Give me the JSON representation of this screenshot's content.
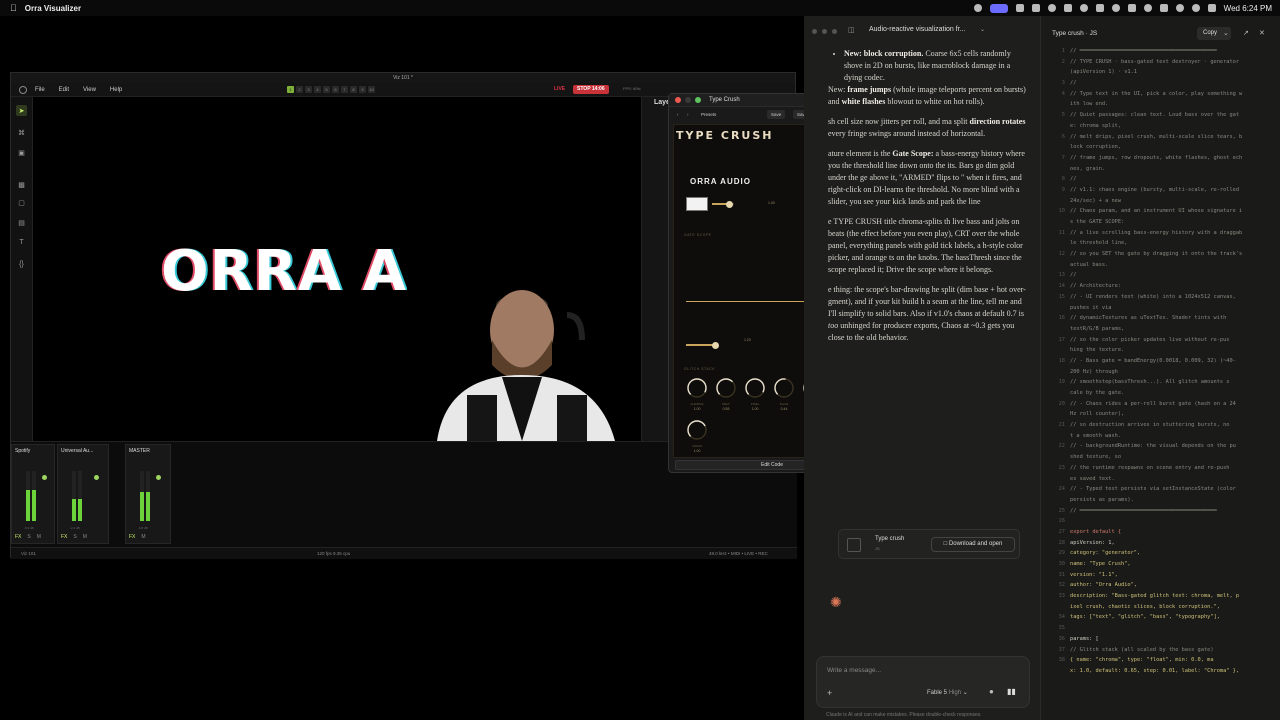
{
  "menubar": {
    "app_name": "Orra Visualizer",
    "clock": "Wed 6:24 PM"
  },
  "viz": {
    "window_title": "Viz 101 *",
    "menu": [
      "File",
      "Edit",
      "View",
      "Help"
    ],
    "scene_tabs": [
      "1",
      "2",
      "3",
      "4",
      "5",
      "6",
      "7",
      "8",
      "9",
      "10"
    ],
    "live_label": "LIVE",
    "stop_label": "STOP 14:06",
    "fps_top": "FPS: 60fc",
    "layers_title": "Layers",
    "canvas_text": "ORRA AUDIO",
    "mixer": {
      "strips": [
        {
          "name": "Spotify",
          "db": "-6.9 dB",
          "level": 0.62
        },
        {
          "name": "Universal Au...",
          "db": "-2.2 dB",
          "level": 0.45
        },
        {
          "name": "MASTER",
          "db": "-6.8 dB",
          "level": 0.58
        }
      ],
      "foot": [
        "FX",
        "S",
        "M"
      ]
    },
    "statusbar": {
      "scene": "Viz 101",
      "fps": "120 fps  9.35 cpu",
      "audio": "48.0 kHz  • MIDI  • LIVE  • REC"
    }
  },
  "type_crush": {
    "window_title": "Type Crush",
    "presets_label": "Presets",
    "save": "Save",
    "save_as": "Save As",
    "delete": "Delete",
    "heading": "TYPE CRUSH",
    "sample_text": "ORRA AUDIO",
    "text_size_val": "1.00",
    "gate_section": "GATE SCOPE",
    "drive_val": "1.20",
    "glitch_section": "GLITCH STACK",
    "knobs": [
      {
        "label": "CHROMA",
        "value": "1.00",
        "level": 0.7
      },
      {
        "label": "MELT",
        "value": "0.55",
        "level": 0.5
      },
      {
        "label": "PIXEL",
        "value": "1.00",
        "level": 0.7
      },
      {
        "label": "SLICE",
        "value": "0.44",
        "level": 0.4
      },
      {
        "label": "GHOST",
        "value": "0.50",
        "level": 0.5
      },
      {
        "label": "CORRU",
        "value": "1.00",
        "level": 0.7
      },
      {
        "label": "GRAIN",
        "value": "1.00",
        "level": 0.55
      }
    ],
    "edit_code": "Edit Code"
  },
  "chat": {
    "title": "Audio-reactive visualization fr...",
    "para1_label": "New: block corruption.",
    "para1_text": " Coarse 6x5 cells randomly shove in 2D on bursts, like macroblock damage in a dying codec.",
    "para2a": "New: ",
    "para2_bold1": "frame jumps",
    "para2b": " (whole image teleports percent on bursts) and ",
    "para2_bold2": "white flashes",
    "para2c": " blowout to white on hot rolls).",
    "para3a": "sh cell size now jitters per roll, and ma split ",
    "para3_bold": "direction rotates",
    "para3b": " every fringe swings around instead of horizontal.",
    "para4a": "ature element is the ",
    "para4_bold": "Gate Scope:",
    "para4b": " a bass-energy history where you the threshold line down onto the its. Bars go dim gold under the ge above it, \"ARMED\" flips to \" when it fires, and right-click on DI-learns the threshold. No more blind with a slider, you see your kick lands and park the line",
    "para5": "e TYPE CRUSH title chroma-splits th live bass and jolts on beats (the effect before you even play), CRT over the whole panel, everything panels with gold tick labels, a h-style color picker, and orange ts on the knobs. The bassThresh since the scope replaced it; Drive the scope where it belongs.",
    "para6a": "e thing: the scope's bar-drawing he split (dim base + hot over-gment), and if your kit build h a seam at the line, tell me and I'll simplify to solid bars. Also if v1.0's chaos at default 0.7 is ",
    "para6_em": "too",
    "para6b": " unhinged for producer exports, Chaos at ~0.3 gets you close to the old behavior.",
    "artifact_name": "Type crush",
    "artifact_sub": "JS",
    "download_label": "Download and open",
    "composer_placeholder": "Write a message...",
    "model": "Fable 5",
    "effort": "High",
    "disclaimer": "Claude is AI and can make mistakes. Please double-check responses."
  },
  "code": {
    "title": "Type crush · JS",
    "copy_label": "Copy",
    "lines": [
      {
        "n": "1",
        "t": "// ═══════════════════════════════════════════",
        "k": "c-com"
      },
      {
        "n": "2",
        "t": "//  TYPE CRUSH · bass-gated text destroyer · generator",
        "k": "c-com"
      },
      {
        "n": "",
        "t": "(apiVersion 1) · v1.1",
        "k": "c-com"
      },
      {
        "n": "3",
        "t": "//",
        "k": "c-com"
      },
      {
        "n": "4",
        "t": "//  Type text in the UI, pick a color, play something w",
        "k": "c-com"
      },
      {
        "n": "",
        "t": "ith low end.",
        "k": "c-com"
      },
      {
        "n": "5",
        "t": "//  Quiet passages: clean text. Loud bass over the gat",
        "k": "c-com"
      },
      {
        "n": "",
        "t": "e: chroma split,",
        "k": "c-com"
      },
      {
        "n": "6",
        "t": "//  melt drips, pixel crush, multi-scale slice tears, b",
        "k": "c-com"
      },
      {
        "n": "",
        "t": "lock corruption,",
        "k": "c-com"
      },
      {
        "n": "7",
        "t": "//  frame jumps, row dropouts, white flashes, ghost ech",
        "k": "c-com"
      },
      {
        "n": "",
        "t": "oes, grain.",
        "k": "c-com"
      },
      {
        "n": "8",
        "t": "//",
        "k": "c-com"
      },
      {
        "n": "9",
        "t": "//  v1.1: chaos engine (bursty, multi-scale, re-rolled",
        "k": "c-com"
      },
      {
        "n": "",
        "t": "24x/sec) + a new",
        "k": "c-com"
      },
      {
        "n": "10",
        "t": "//  Chaos param, and an instrument UI whose signature i",
        "k": "c-com"
      },
      {
        "n": "",
        "t": "s the GATE SCOPE:",
        "k": "c-com"
      },
      {
        "n": "11",
        "t": "//  a live scrolling bass-energy history with a draggab",
        "k": "c-com"
      },
      {
        "n": "",
        "t": "le threshold line,",
        "k": "c-com"
      },
      {
        "n": "12",
        "t": "//  so you SET the gate by dragging it onto the track's",
        "k": "c-com"
      },
      {
        "n": "",
        "t": "actual bass.",
        "k": "c-com"
      },
      {
        "n": "13",
        "t": "//",
        "k": "c-com"
      },
      {
        "n": "14",
        "t": "//  Architecture:",
        "k": "c-com"
      },
      {
        "n": "15",
        "t": "//    - UI renders text (white) into a 1024x512 canvas,",
        "k": "c-com"
      },
      {
        "n": "",
        "t": "pushes it via",
        "k": "c-com"
      },
      {
        "n": "16",
        "t": "//      dynamicTextures as uTextTex. Shader tints with",
        "k": "c-com"
      },
      {
        "n": "",
        "t": "textR/G/B params,",
        "k": "c-com"
      },
      {
        "n": "17",
        "t": "//      so the color picker updates live without re-pus",
        "k": "c-com"
      },
      {
        "n": "",
        "t": "hing the texture.",
        "k": "c-com"
      },
      {
        "n": "18",
        "t": "//    - Bass gate = bandEnergy(0.0018, 0.009, 32) (~40-",
        "k": "c-com"
      },
      {
        "n": "",
        "t": "200 Hz) through",
        "k": "c-com"
      },
      {
        "n": "19",
        "t": "//      smoothstep(bassThresh...). All glitch amounts s",
        "k": "c-com"
      },
      {
        "n": "",
        "t": "cale by the gate.",
        "k": "c-com"
      },
      {
        "n": "20",
        "t": "//    - Chaos rides a per-roll burst gate (hash on a 24",
        "k": "c-com"
      },
      {
        "n": "",
        "t": "Hz roll counter),",
        "k": "c-com"
      },
      {
        "n": "21",
        "t": "//      so destruction arrives in stuttering bursts, no",
        "k": "c-com"
      },
      {
        "n": "",
        "t": "t a smooth wash.",
        "k": "c-com"
      },
      {
        "n": "22",
        "t": "//    - backgroundRuntime: the visual depends on the pu",
        "k": "c-com"
      },
      {
        "n": "",
        "t": "shed texture, so",
        "k": "c-com"
      },
      {
        "n": "23",
        "t": "//      the runtime respawns on scene entry and re-push",
        "k": "c-com"
      },
      {
        "n": "",
        "t": "es saved text.",
        "k": "c-com"
      },
      {
        "n": "24",
        "t": "//    - Typed text persists via setInstanceState (color",
        "k": "c-com"
      },
      {
        "n": "",
        "t": "persists as params).",
        "k": "c-com"
      },
      {
        "n": "25",
        "t": "// ═══════════════════════════════════════════",
        "k": "c-com"
      },
      {
        "n": "26",
        "t": "",
        "k": "c-txt"
      },
      {
        "n": "27",
        "t": "export default {",
        "k": "c-kw"
      },
      {
        "n": "28",
        "t": "  apiVersion: 1,",
        "k": "c-txt"
      },
      {
        "n": "29",
        "t": "  category: \"generator\",",
        "k": "c-str"
      },
      {
        "n": "30",
        "t": "  name: \"Type Crush\",",
        "k": "c-str"
      },
      {
        "n": "31",
        "t": "  version: \"1.1\",",
        "k": "c-str"
      },
      {
        "n": "32",
        "t": "  author: \"Orra Audio\",",
        "k": "c-str"
      },
      {
        "n": "33",
        "t": "  description: \"Bass-gated glitch text: chroma, melt, p",
        "k": "c-str"
      },
      {
        "n": "",
        "t": "ixel crush, chaotic slices, block corruption.\",",
        "k": "c-str"
      },
      {
        "n": "34",
        "t": "  tags: [\"text\", \"glitch\", \"bass\", \"typography\"],",
        "k": "c-str"
      },
      {
        "n": "35",
        "t": "",
        "k": "c-txt"
      },
      {
        "n": "36",
        "t": "  params: [",
        "k": "c-txt"
      },
      {
        "n": "37",
        "t": "    // Glitch stack (all scaled by the bass gate)",
        "k": "c-com"
      },
      {
        "n": "38",
        "t": "    { name: \"chroma\",     type: \"float\", min: 0.0,  ma",
        "k": "c-str"
      },
      {
        "n": "",
        "t": "x: 1.0, default: 0.65, step: 0.01, label: \"Chroma\" },",
        "k": "c-str"
      }
    ]
  }
}
